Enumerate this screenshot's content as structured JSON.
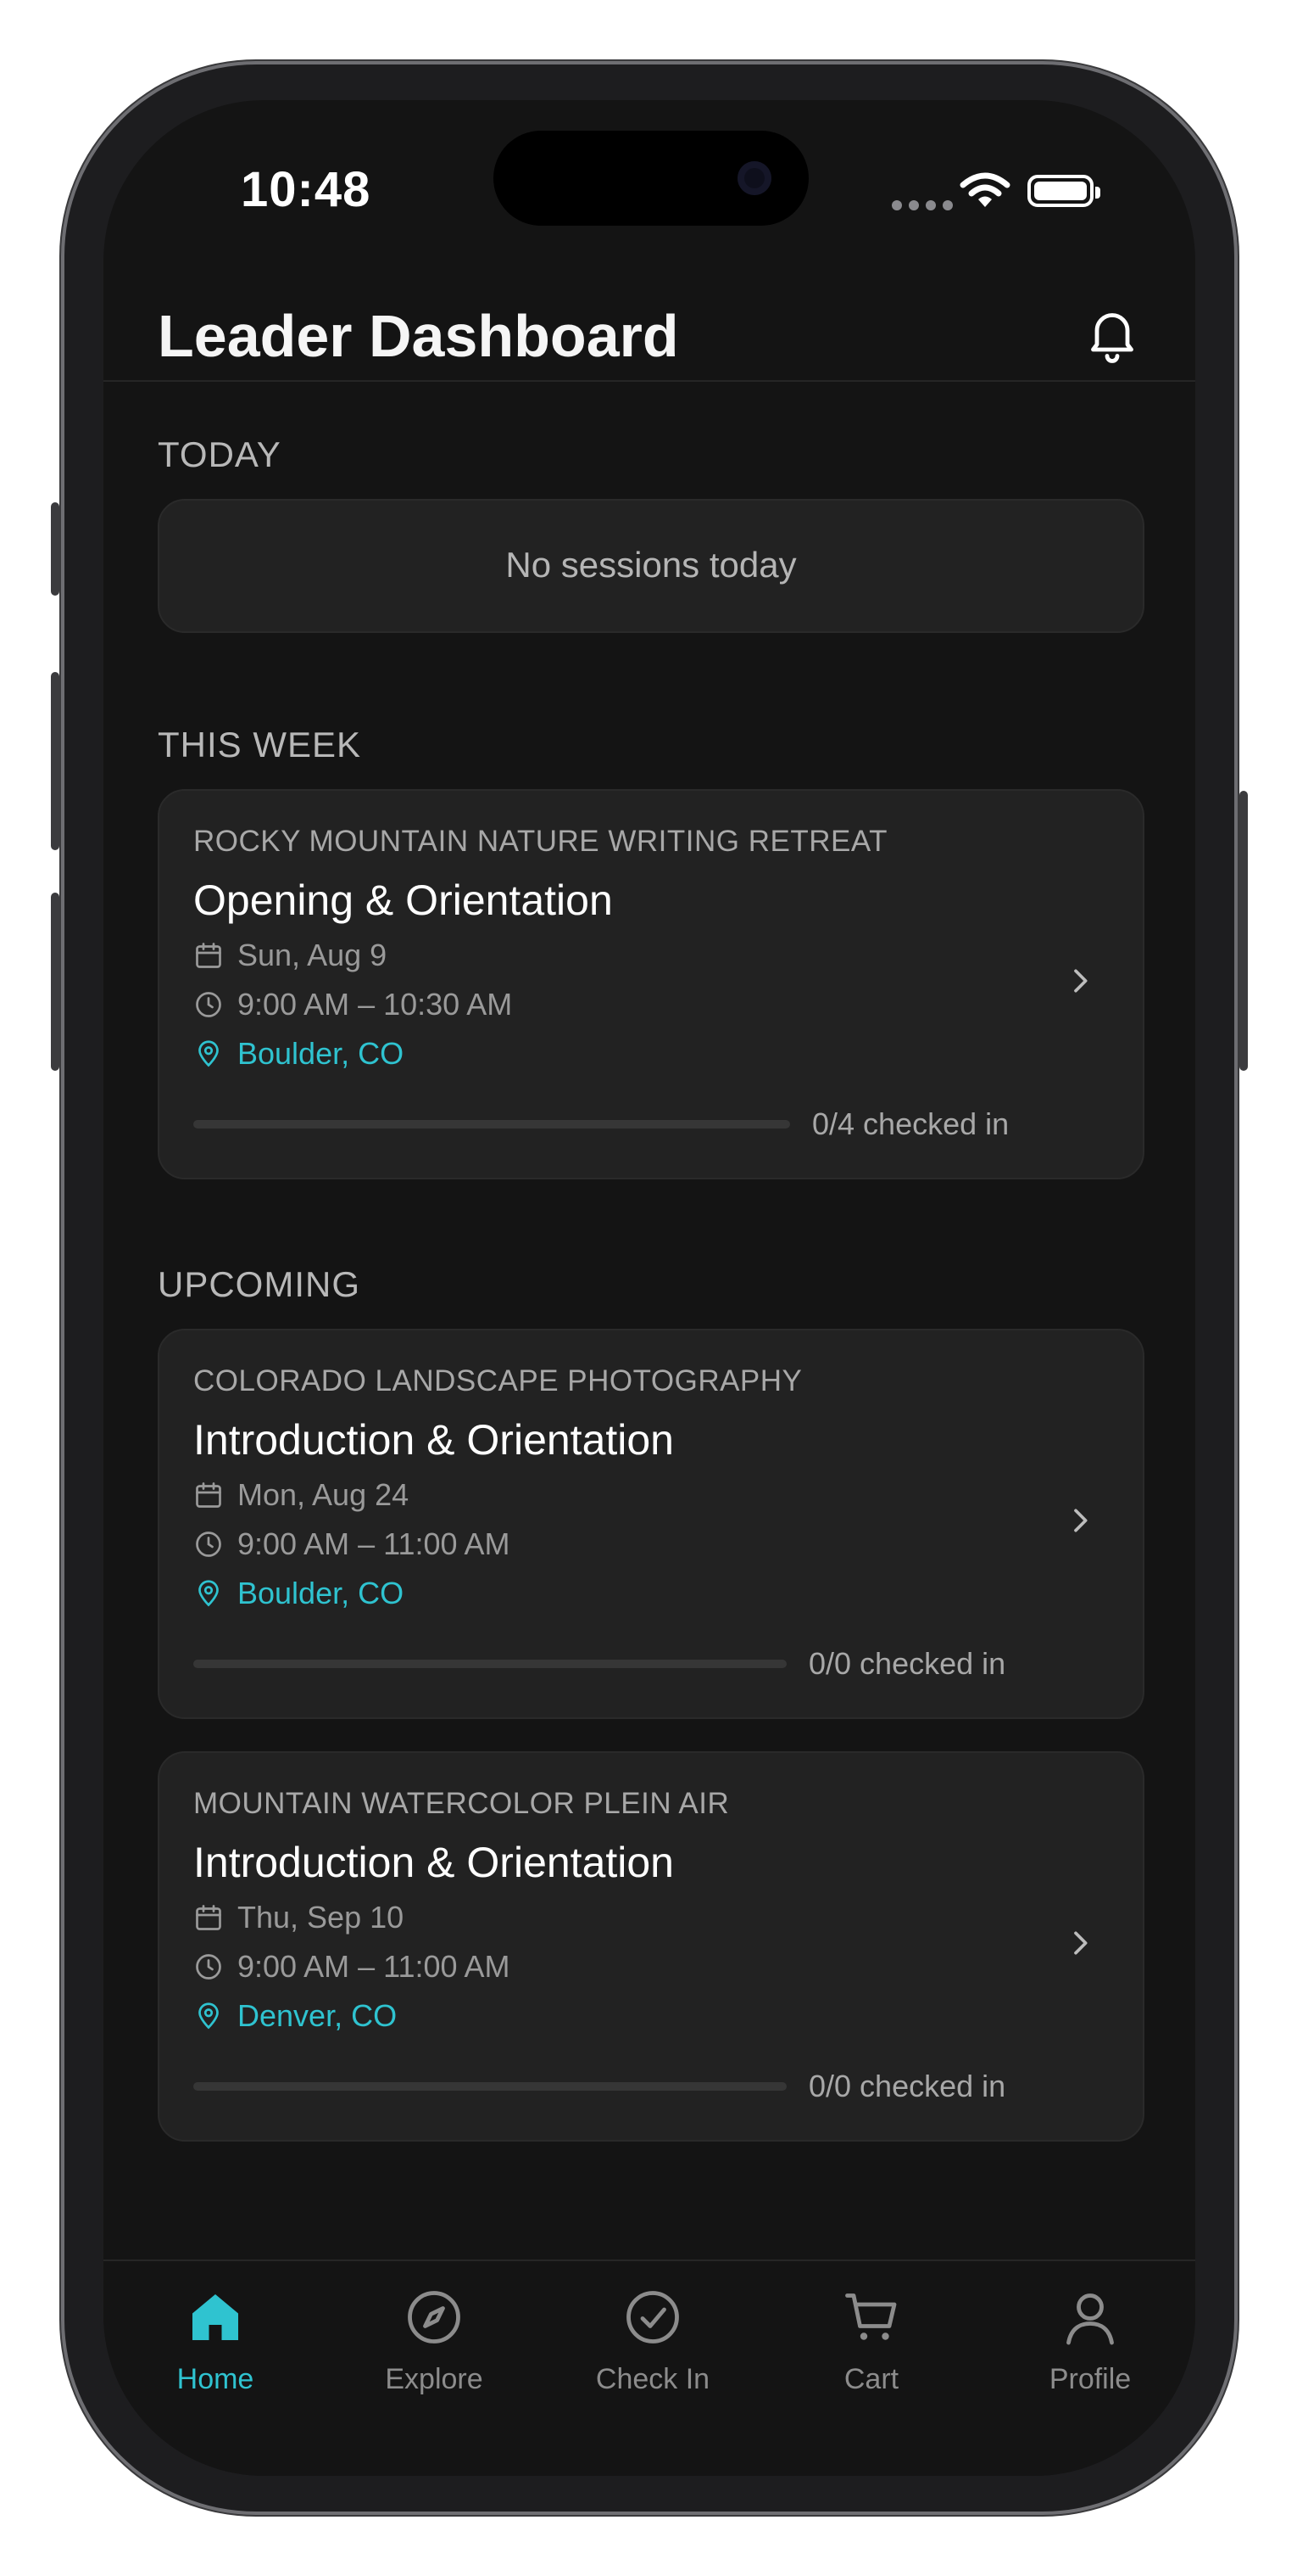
{
  "status_bar": {
    "time": "10:48"
  },
  "header": {
    "title": "Leader Dashboard",
    "bell_icon": "bell-icon"
  },
  "colors": {
    "accent": "#2fc3d0",
    "background": "#141414",
    "card": "#222222"
  },
  "today": {
    "label": "TODAY",
    "empty_message": "No sessions today"
  },
  "this_week": {
    "label": "THIS WEEK",
    "sessions": [
      {
        "program": "ROCKY MOUNTAIN NATURE WRITING RETREAT",
        "title": "Opening & Orientation",
        "date": "Sun, Aug 9",
        "time": "9:00 AM – 10:30 AM",
        "location": "Boulder, CO",
        "checked_in": "0/4 checked in",
        "progress": 0
      }
    ]
  },
  "upcoming": {
    "label": "UPCOMING",
    "sessions": [
      {
        "program": "COLORADO LANDSCAPE PHOTOGRAPHY",
        "title": "Introduction & Orientation",
        "date": "Mon, Aug 24",
        "time": "9:00 AM – 11:00 AM",
        "location": "Boulder, CO",
        "checked_in": "0/0 checked in",
        "progress": 0
      },
      {
        "program": "MOUNTAIN WATERCOLOR PLEIN AIR",
        "title": "Introduction & Orientation",
        "date": "Thu, Sep 10",
        "time": "9:00 AM – 11:00 AM",
        "location": "Denver, CO",
        "checked_in": "0/0 checked in",
        "progress": 0
      }
    ]
  },
  "tabs": [
    {
      "label": "Home",
      "icon": "home-icon",
      "active": true
    },
    {
      "label": "Explore",
      "icon": "compass-icon",
      "active": false
    },
    {
      "label": "Check In",
      "icon": "check-circle-icon",
      "active": false
    },
    {
      "label": "Cart",
      "icon": "cart-icon",
      "active": false
    },
    {
      "label": "Profile",
      "icon": "person-icon",
      "active": false
    }
  ]
}
